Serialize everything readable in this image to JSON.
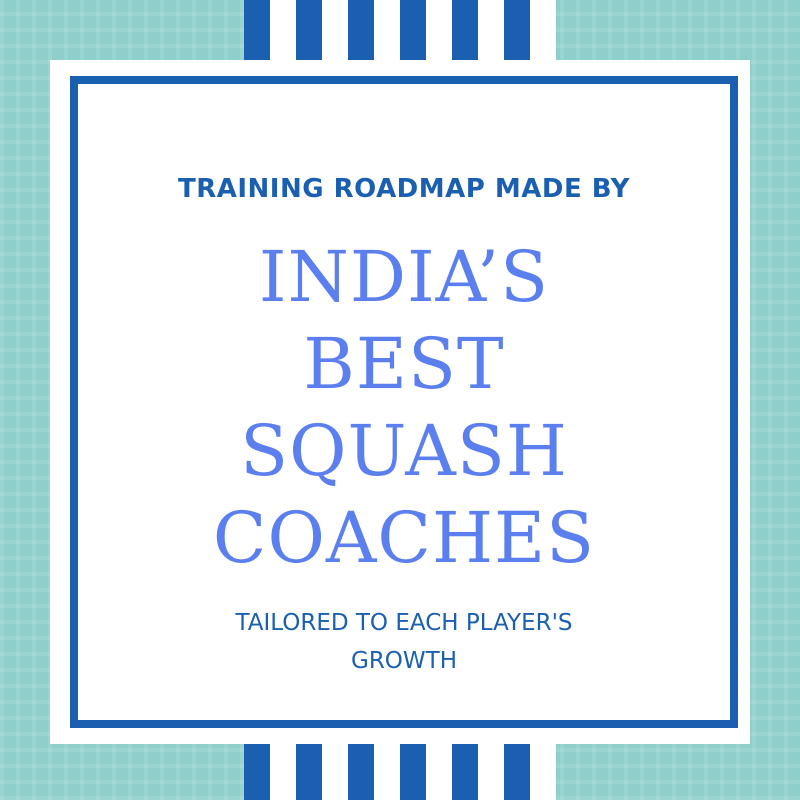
{
  "colors": {
    "background_teal": "#8fcfcb",
    "stripe_blue": "#1a5fb0",
    "headline_blue": "#5b7fee",
    "card_white": "#ffffff"
  },
  "kicker": "TRAINING ROADMAP MADE BY",
  "headline": [
    "INDIA’S",
    "BEST",
    "SQUASH",
    "COACHES"
  ],
  "tagline": [
    "TAILORED TO EACH PLAYER'S",
    "GROWTH"
  ]
}
